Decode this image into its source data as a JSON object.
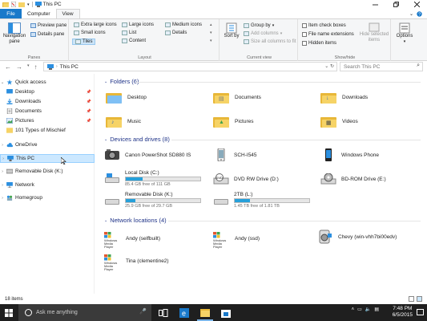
{
  "window": {
    "title": "This PC"
  },
  "tabs": [
    {
      "label": "File"
    },
    {
      "label": "Computer"
    },
    {
      "label": "View"
    }
  ],
  "ribbon": {
    "panes": {
      "navigation_pane": "Navigation pane",
      "preview_pane": "Preview pane",
      "details_pane": "Details pane",
      "group_label": "Panes"
    },
    "layout": {
      "extra_large_icons": "Extra large icons",
      "large_icons": "Large icons",
      "medium_icons": "Medium icons",
      "small_icons": "Small icons",
      "list": "List",
      "details": "Details",
      "tiles": "Tiles",
      "content": "Content",
      "group_label": "Layout"
    },
    "current_view": {
      "sort_by": "Sort by",
      "group_by": "Group by",
      "add_columns": "Add columns",
      "size_all_columns": "Size all columns to fit",
      "group_label": "Current view"
    },
    "show_hide": {
      "item_check_boxes": "Item check boxes",
      "file_name_extensions": "File name extensions",
      "hidden_items": "Hidden items",
      "hide_selected": "Hide selected items",
      "group_label": "Show/hide"
    },
    "options": "Options"
  },
  "address": {
    "path": "This PC",
    "search_placeholder": "Search This PC"
  },
  "nav": {
    "quick_access": "Quick access",
    "items": [
      {
        "label": "Desktop"
      },
      {
        "label": "Downloads"
      },
      {
        "label": "Documents"
      },
      {
        "label": "Pictures"
      },
      {
        "label": "101 Types of Mischief"
      }
    ],
    "onedrive": "OneDrive",
    "this_pc": "This PC",
    "removable": "Removable Disk (K:)",
    "network": "Network",
    "homegroup": "Homegroup"
  },
  "folders": {
    "header": "Folders (6)",
    "items": [
      {
        "label": "Desktop"
      },
      {
        "label": "Documents"
      },
      {
        "label": "Downloads"
      },
      {
        "label": "Music"
      },
      {
        "label": "Pictures"
      },
      {
        "label": "Videos"
      }
    ]
  },
  "devices": {
    "header": "Devices and drives (8)",
    "canon": "Canon PowerShot SD880 IS",
    "sch": "SCH-I545",
    "windows_phone": "Windows Phone",
    "local_disk": {
      "label": "Local Disk (C:)",
      "free": "85.4 GB free of 111 GB",
      "used_fraction": 0.23
    },
    "dvd": "DVD RW Drive (D:)",
    "bd": "BD-ROM Drive (E:)",
    "removable": {
      "label": "Removable Disk (K:)",
      "free": "25.9 GB free of 29.7 GB",
      "used_fraction": 0.13
    },
    "tb2": {
      "label": "2TB (L:)",
      "free": "1.45 TB free of 1.81 TB",
      "used_fraction": 0.2
    }
  },
  "network_locations": {
    "header": "Network locations (4)",
    "items": [
      {
        "label": "Andy (selfbuilt)"
      },
      {
        "label": "Andy (ssd)"
      },
      {
        "label": "Chevy (win-vhh7bi00edv)"
      },
      {
        "label": "Tina (clementine2)"
      }
    ],
    "logo_text": "Windows Media Player"
  },
  "status": {
    "count": "18 items"
  },
  "taskbar": {
    "search": "Ask me anything",
    "time": "7:48 PM",
    "date": "6/5/2015"
  },
  "colors": {
    "accent": "#1979ca",
    "selected": "#cce8ff",
    "section": "#1e3287",
    "bar_fill": "#26a0da"
  }
}
